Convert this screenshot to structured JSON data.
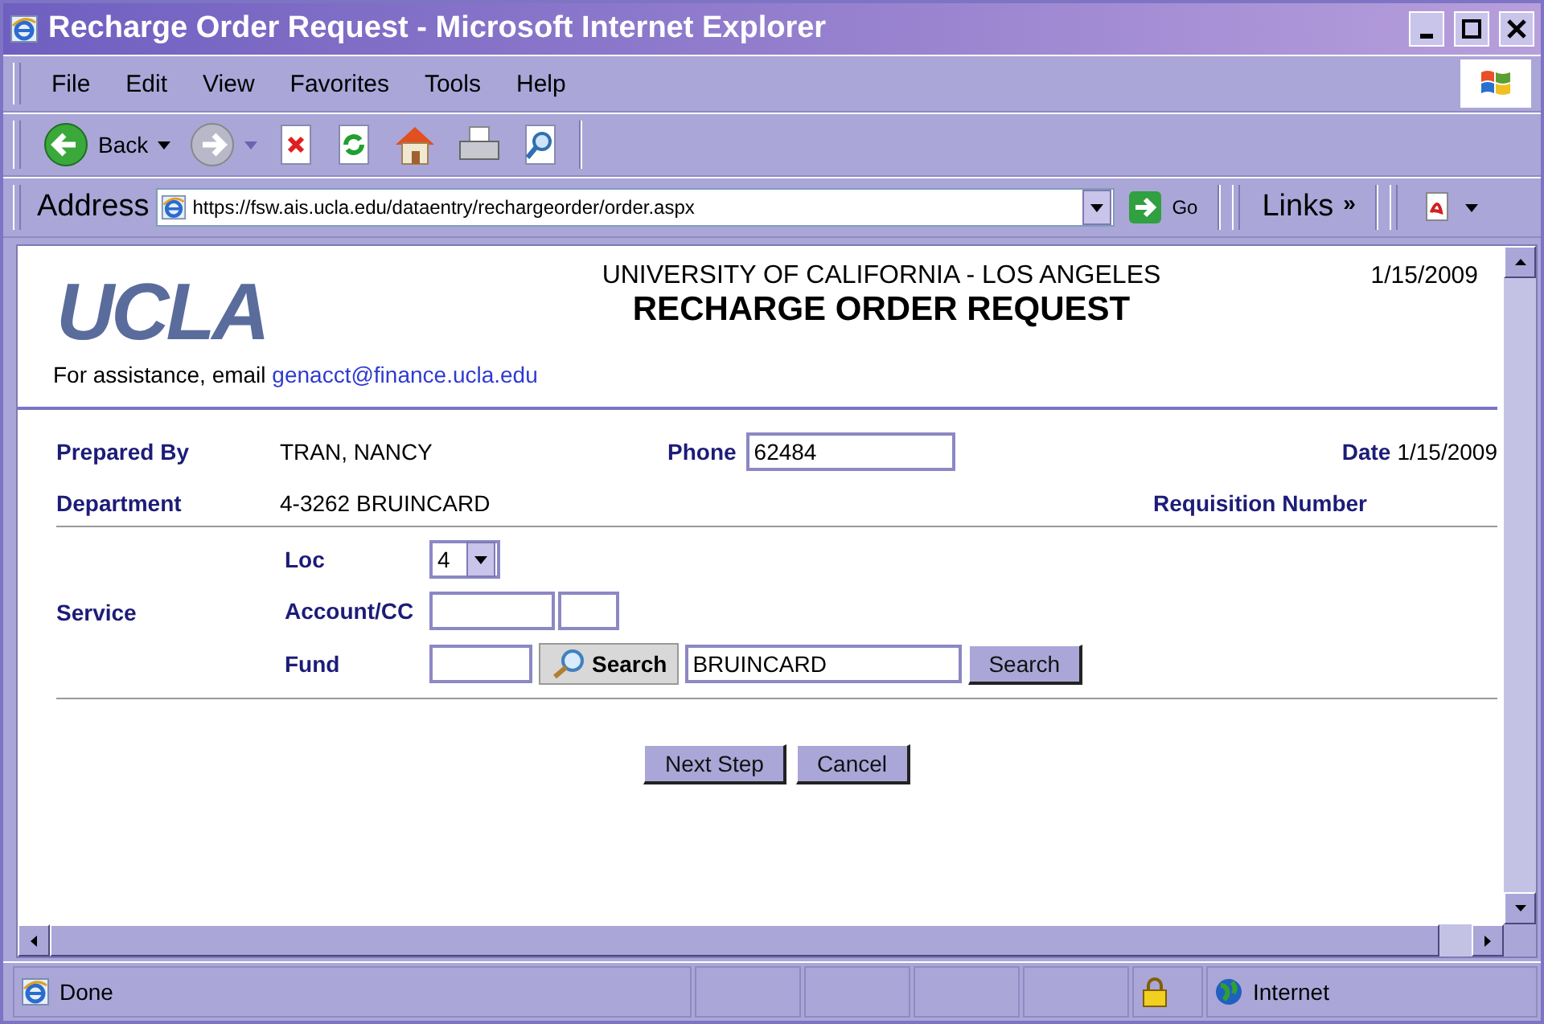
{
  "window": {
    "title": "Recharge Order Request - Microsoft Internet Explorer"
  },
  "menu": [
    "File",
    "Edit",
    "View",
    "Favorites",
    "Tools",
    "Help"
  ],
  "toolbar": {
    "back": "Back"
  },
  "address_bar": {
    "label": "Address",
    "url": "https://fsw.ais.ucla.edu/dataentry/rechargeorder/order.aspx",
    "go": "Go",
    "links": "Links",
    "links_more": "»"
  },
  "page": {
    "logo": "UCLA",
    "university": "UNIVERSITY OF CALIFORNIA - LOS ANGELES",
    "heading": "RECHARGE ORDER REQUEST",
    "date": "1/15/2009",
    "assistance": "For assistance, email",
    "email": "genacct@finance.ucla.edu"
  },
  "form": {
    "prepared_by_label": "Prepared By",
    "prepared_by": "TRAN, NANCY",
    "phone_label": "Phone",
    "phone": "62484",
    "date_label": "Date",
    "date": "1/15/2009",
    "department_label": "Department",
    "department": "4-3262 BRUINCARD",
    "requisition_label": "Requisition Number",
    "service_label": "Service",
    "loc_label": "Loc",
    "loc": "4",
    "account_label": "Account/CC",
    "fund_label": "Fund",
    "fund_search": "Search",
    "fund_name": "BRUINCARD",
    "search": "Search"
  },
  "buttons": [
    "Next Step",
    "Cancel"
  ],
  "status_bar": {
    "text": "Done",
    "zone": "Internet"
  }
}
